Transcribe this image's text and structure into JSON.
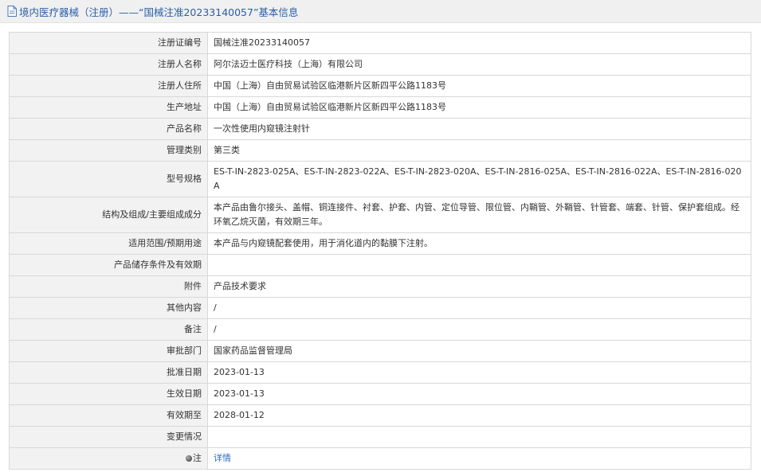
{
  "header": {
    "title": "境内医疗器械（注册）——“国械注准20233140057”基本信息"
  },
  "colors": {
    "title": "#2a5ea8",
    "label_bg": "#f2f2f2",
    "border": "#d8d8d8",
    "link": "#2a6ec6"
  },
  "icons": {
    "header": "document-icon",
    "note": "dot-icon"
  },
  "rows": [
    {
      "label": "注册证编号",
      "value": "国械注准20233140057"
    },
    {
      "label": "注册人名称",
      "value": "阿尔法迈士医疗科技（上海）有限公司"
    },
    {
      "label": "注册人住所",
      "value": "中国（上海）自由贸易试验区临港新片区新四平公路1183号"
    },
    {
      "label": "生产地址",
      "value": "中国（上海）自由贸易试验区临港新片区新四平公路1183号"
    },
    {
      "label": "产品名称",
      "value": "一次性使用内窥镜注射针"
    },
    {
      "label": "管理类别",
      "value": "第三类"
    },
    {
      "label": "型号规格",
      "value": "ES-T-IN-2823-025A、ES-T-IN-2823-022A、ES-T-IN-2823-020A、ES-T-IN-2816-025A、ES-T-IN-2816-022A、ES-T-IN-2816-020A"
    },
    {
      "label": "结构及组成/主要组成成分",
      "value": "本产品由鲁尔接头、盖帽、铜连接件、衬套、护套、内管、定位导管、限位管、内鞘管、外鞘管、针管套、端套、针管、保护套组成。经环氧乙烷灭菌，有效期三年。"
    },
    {
      "label": "适用范围/预期用途",
      "value": "本产品与内窥镜配套使用，用于消化道内的黏膜下注射。"
    },
    {
      "label": "产品储存条件及有效期",
      "value": ""
    },
    {
      "label": "附件",
      "value": "产品技术要求"
    },
    {
      "label": "其他内容",
      "value": "/"
    },
    {
      "label": "备注",
      "value": "/"
    },
    {
      "label": "审批部门",
      "value": "国家药品监督管理局"
    },
    {
      "label": "批准日期",
      "value": "2023-01-13"
    },
    {
      "label": "生效日期",
      "value": "2023-01-13"
    },
    {
      "label": "有效期至",
      "value": "2028-01-12"
    },
    {
      "label": "变更情况",
      "value": ""
    }
  ],
  "note_row": {
    "label": "注",
    "link_text": "详情"
  }
}
